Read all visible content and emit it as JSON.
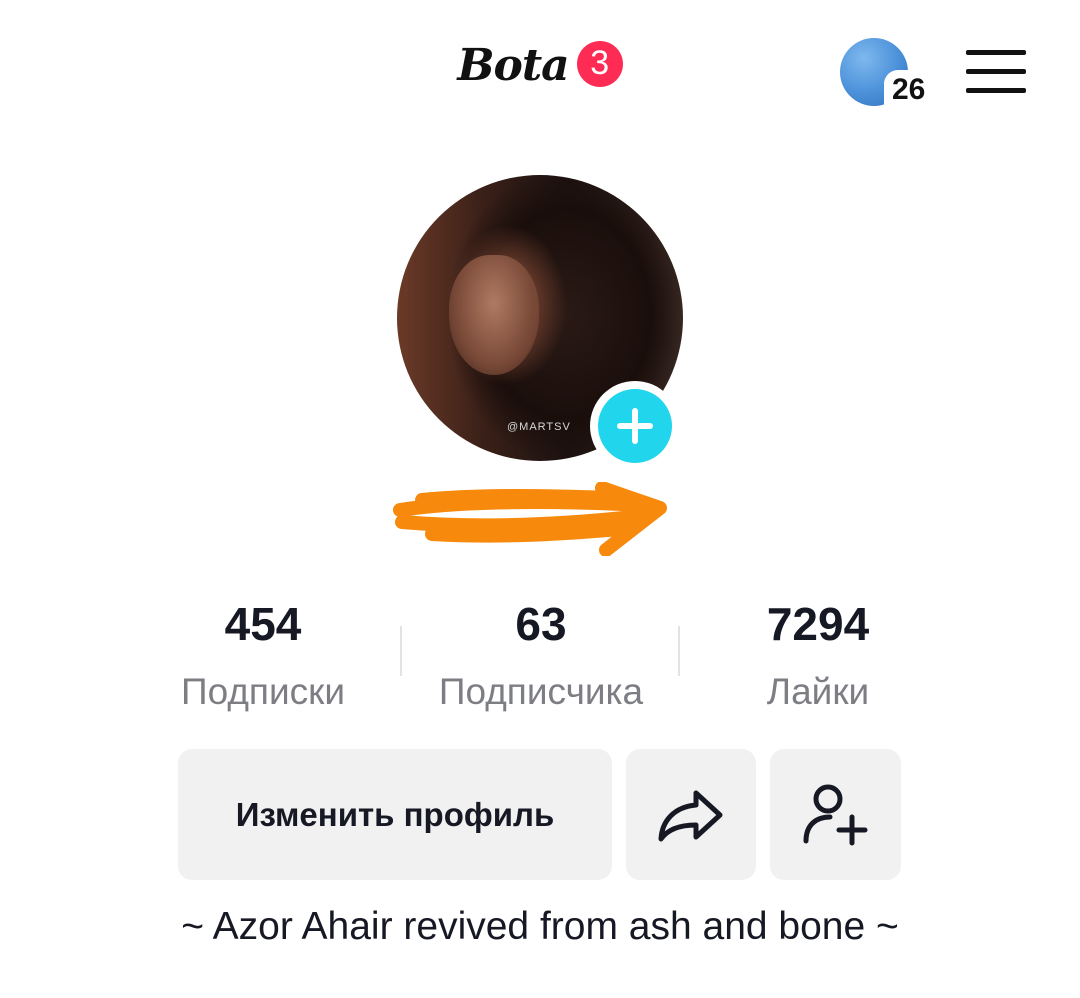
{
  "header": {
    "username": "Bota",
    "notification_count": "3",
    "stories_count": "26"
  },
  "stats": [
    {
      "value": "454",
      "label": "Подписки"
    },
    {
      "value": "63",
      "label": "Подписчика"
    },
    {
      "value": "7294",
      "label": "Лайки"
    }
  ],
  "avatar": {
    "watermark": "@MARTSV"
  },
  "actions": {
    "edit_profile": "Изменить профиль"
  },
  "bio": "~ Azor Ahair revived from ash and bone ~",
  "colors": {
    "badge": "#fe2c55",
    "add_photo": "#20d5ec",
    "scribble": "#f7890c",
    "button_bg": "#f1f1f2"
  }
}
